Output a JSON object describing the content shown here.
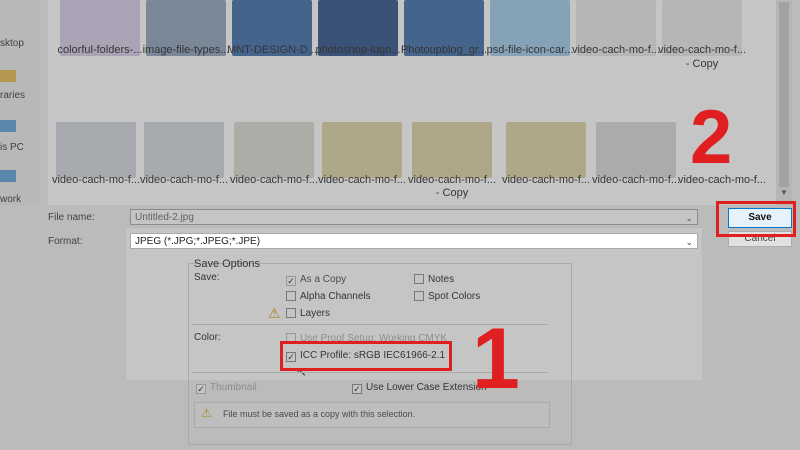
{
  "nav": {
    "items": [
      {
        "label": "sktop"
      },
      {
        "label": "raries"
      },
      {
        "label": "is PC"
      },
      {
        "label": "work"
      }
    ]
  },
  "files": {
    "row1": [
      {
        "label": "colorful-folders-..."
      },
      {
        "label": "image-file-types..."
      },
      {
        "label": "MNT-DESIGN-D..."
      },
      {
        "label": "photoshop-logo..."
      },
      {
        "label": "Photoupblog_gr..."
      },
      {
        "label": "psd-file-icon-car..."
      },
      {
        "label": "video-cach-mo-f..."
      },
      {
        "label": "video-cach-mo-f...",
        "sub": "- Copy"
      }
    ],
    "row2": [
      {
        "label": "video-cach-mo-f..."
      },
      {
        "label": "video-cach-mo-f..."
      },
      {
        "label": "video-cach-mo-f..."
      },
      {
        "label": "video-cach-mo-f..."
      },
      {
        "label": "video-cach-mo-f...",
        "sub": "- Copy"
      },
      {
        "label": "video-cach-mo-f..."
      },
      {
        "label": "video-cach-mo-f..."
      },
      {
        "label": "video-cach-mo-f..."
      },
      {
        "label": "video-cach-mo-f..."
      }
    ]
  },
  "form": {
    "file_name_label": "File name:",
    "file_name_value": "Untitled-2.jpg",
    "format_label": "Format:",
    "format_value": "JPEG (*.JPG;*.JPEG;*.JPE)",
    "save_button": "Save",
    "cancel_button": "Cancel"
  },
  "save_options": {
    "title": "Save Options",
    "save_label": "Save:",
    "as_copy": "As a Copy",
    "alpha_channels": "Alpha Channels",
    "layers": "Layers",
    "notes": "Notes",
    "spot_colors": "Spot Colors",
    "color_label": "Color:",
    "use_proof": "Use Proof Setup:  Working CMYK",
    "icc_profile": "ICC Profile:  sRGB IEC61966-2.1",
    "thumbnail": "Thumbnail",
    "lower_case": "Use Lower Case Extension",
    "warning": "File must be saved as a copy with this selection."
  },
  "annotations": {
    "step1": "1",
    "step2": "2"
  },
  "colors": {
    "highlight": "#e02020"
  }
}
